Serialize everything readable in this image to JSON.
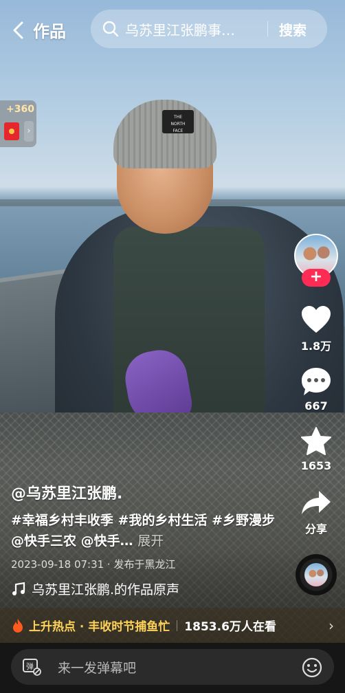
{
  "header": {
    "back_label": "作品",
    "search_placeholder": "乌苏里江张鹏事…",
    "search_button": "搜索"
  },
  "red_packet": {
    "count": "+360"
  },
  "rail": {
    "follow": "+",
    "like_count": "1.8万",
    "comment_count": "667",
    "favorite_count": "1653",
    "share_label": "分享"
  },
  "caption": {
    "author": "@乌苏里江张鹏.",
    "description": "#幸福乡村丰收季 #我的乡村生活 #乡野漫步 @快手三农 @快手…",
    "expand": "展开",
    "meta": "2023-09-18 07:31 · 发布于黑龙江",
    "sound": "乌苏里江张鹏.的作品原声"
  },
  "hotbar": {
    "label": "上升热点 · 丰收时节捕鱼忙",
    "count": "1853.6万人在看"
  },
  "bottom": {
    "comment_placeholder": "来一发弹幕吧"
  },
  "icons": {
    "back": "chevron-left-icon",
    "search": "search-icon",
    "like": "heart-icon",
    "comment": "speech-bubble-icon",
    "favorite": "star-icon",
    "share": "share-arrow-icon",
    "music": "music-note-icon",
    "hot": "flame-icon",
    "danmu": "danmu-toggle-icon",
    "emoji": "emoji-icon"
  },
  "colors": {
    "follow_red": "#fe2c55",
    "hot_yellow": "#ffd35a",
    "red_packet": "#e5262c"
  }
}
